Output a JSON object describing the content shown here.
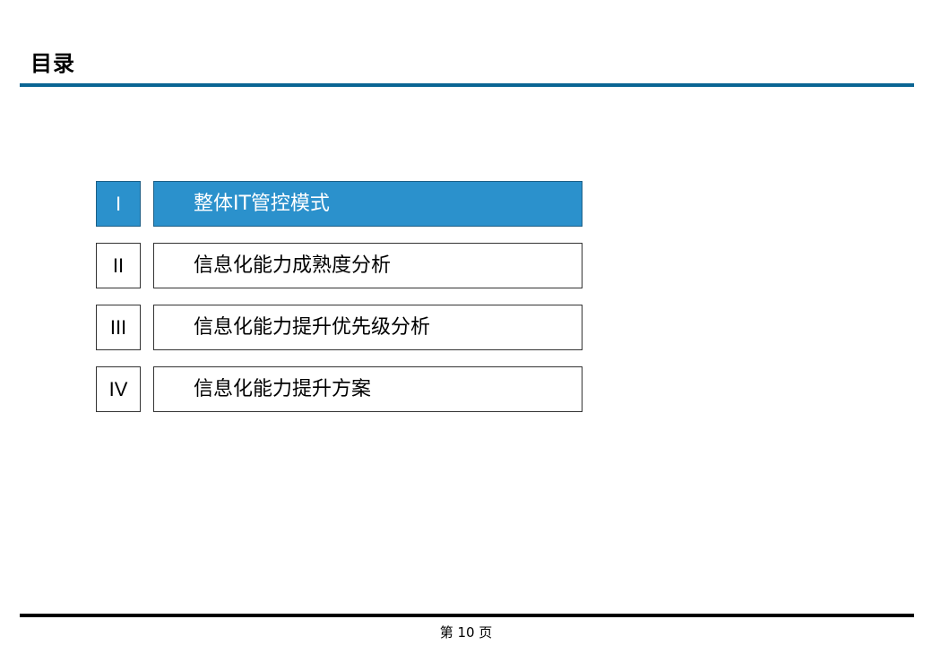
{
  "page": {
    "title": "目录",
    "footer": "第 10 页"
  },
  "toc": {
    "items": [
      {
        "numeral": "I",
        "label": "整体IT管控模式",
        "active": true
      },
      {
        "numeral": "II",
        "label": "信息化能力成熟度分析",
        "active": false
      },
      {
        "numeral": "III",
        "label": "信息化能力提升优先级分析",
        "active": false
      },
      {
        "numeral": "IV",
        "label": "信息化能力提升方案",
        "active": false
      }
    ]
  },
  "colors": {
    "title_rule": "#0a6593",
    "active_fill": "#2b91cc",
    "footer_rule": "#000000"
  }
}
